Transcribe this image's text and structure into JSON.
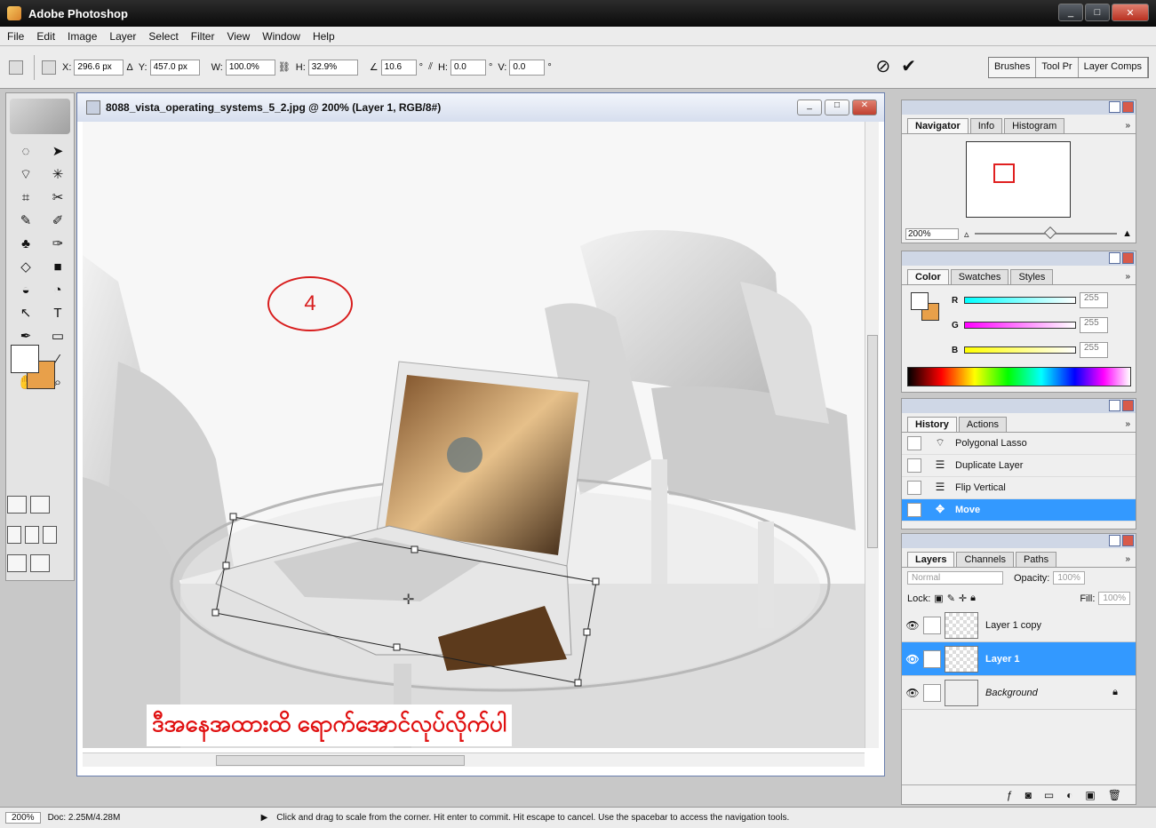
{
  "window": {
    "title": "Adobe Photoshop"
  },
  "menu": [
    "File",
    "Edit",
    "Image",
    "Layer",
    "Select",
    "Filter",
    "View",
    "Window",
    "Help"
  ],
  "options": {
    "x_label": "X:",
    "x_value": "296.6 px",
    "y_label": "Y:",
    "y_value": "457.0 px",
    "w_label": "W:",
    "w_value": "100.0%",
    "h_label": "H:",
    "h_value": "32.9%",
    "angle_value": "10.6",
    "skew_h_label": "H:",
    "skew_h_value": "0.0",
    "skew_v_label": "V:",
    "skew_v_value": "0.0",
    "degree_symbol": "°"
  },
  "palette_well": [
    "Brushes",
    "Tool Pr",
    "Layer Comps"
  ],
  "document": {
    "title": "8088_vista_operating_systems_5_2.jpg @ 200% (Layer 1, RGB/8#)",
    "step_number": "4",
    "caption": "ဒီအနေအထားထိ ရောက်အောင်လုပ်လိုက်ပါ"
  },
  "navigator": {
    "tabs": [
      "Navigator",
      "Info",
      "Histogram"
    ],
    "zoom": "200%"
  },
  "color": {
    "tabs": [
      "Color",
      "Swatches",
      "Styles"
    ],
    "channels": [
      {
        "label": "R",
        "value": "255"
      },
      {
        "label": "G",
        "value": "255"
      },
      {
        "label": "B",
        "value": "255"
      }
    ],
    "fg": "#ffffff",
    "bg": "#e8a04a"
  },
  "history": {
    "tabs": [
      "History",
      "Actions"
    ],
    "items": [
      "Polygonal Lasso",
      "Duplicate Layer",
      "Flip Vertical",
      "Move"
    ]
  },
  "layers": {
    "tabs": [
      "Layers",
      "Channels",
      "Paths"
    ],
    "blend_mode": "Normal",
    "opacity_label": "Opacity:",
    "opacity": "100%",
    "lock_label": "Lock:",
    "fill_label": "Fill:",
    "fill": "100%",
    "items": [
      "Layer 1 copy",
      "Layer 1",
      "Background"
    ]
  },
  "status": {
    "zoom": "200%",
    "doc": "Doc: 2.25M/4.28M",
    "hint": "Click and drag to scale from the corner. Hit enter to commit. Hit escape to cancel. Use the spacebar to access the navigation tools."
  }
}
